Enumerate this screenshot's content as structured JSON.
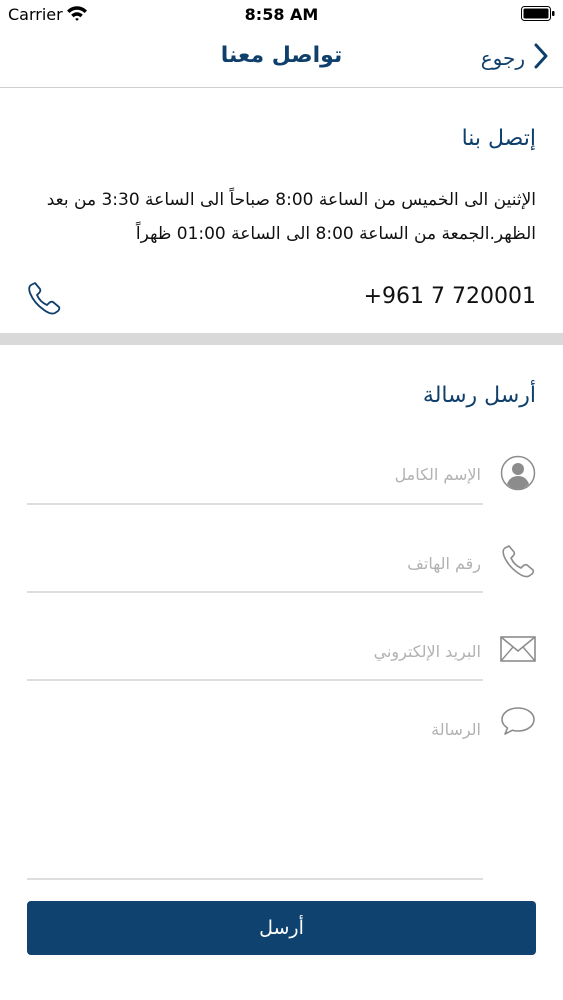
{
  "status_bar": {
    "carrier": "Carrier",
    "time": "8:58 AM"
  },
  "nav": {
    "title": "تواصل معنا",
    "back_label": "رجوع"
  },
  "contact": {
    "heading": "إتصل بنا",
    "hours": "الإثنين الى الخميس من الساعة 8:00 صباحاً الى الساعة 3:30 من بعد الظهر.الجمعة من الساعة 8:00 الى الساعة 01:00 ظهراً",
    "phone": "+961 7 720001"
  },
  "message_form": {
    "heading": "أرسل رسالة",
    "full_name_placeholder": "الإسم الكامل",
    "phone_placeholder": "رقم الهاتف",
    "email_placeholder": "البريد الإلكتروني",
    "message_placeholder": "الرسالة",
    "submit_label": "أرسل"
  },
  "colors": {
    "brand": "#0f3f6b",
    "button": "#0f426f",
    "icon": "#8c8c8c",
    "separator": "#d9d9d9"
  }
}
